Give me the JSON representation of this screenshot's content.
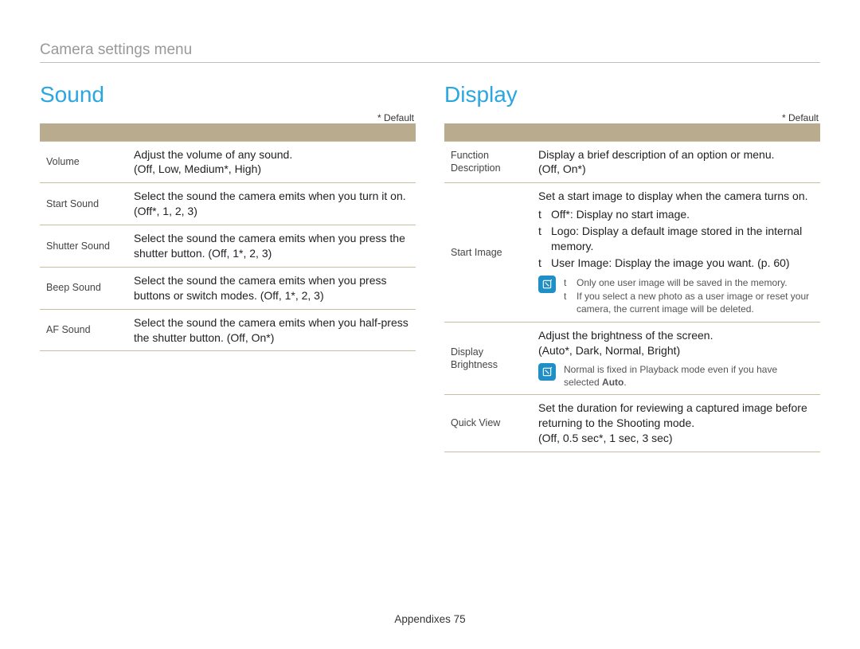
{
  "page_title": "Camera settings menu",
  "footer": {
    "label": "Appendixes",
    "page": "75"
  },
  "default_note": "* Default",
  "bullet_mark": "t",
  "sound": {
    "heading": "Sound",
    "header": {
      "item": "",
      "desc": ""
    },
    "rows": [
      {
        "item": "Volume",
        "desc": "Adjust the volume of any sound.",
        "opts": "(Off, Low, Medium*, High)"
      },
      {
        "item": "Start Sound",
        "desc": "Select the sound the camera emits when you turn it on. (Off*, 1, 2, 3)"
      },
      {
        "item": "Shutter Sound",
        "desc": "Select the sound the camera emits when you press the shutter button. (Off, 1*, 2, 3)"
      },
      {
        "item": "Beep Sound",
        "desc": "Select the sound the camera emits when you press buttons or switch modes. (Off, 1*, 2, 3)"
      },
      {
        "item": "AF Sound",
        "desc": "Select the sound the camera emits when you half-press the shutter button. (Off, On*)"
      }
    ]
  },
  "display": {
    "heading": "Display",
    "header": {
      "item": "",
      "desc": ""
    },
    "rows": {
      "func": {
        "item": "Function Description",
        "desc": "Display a brief description of an option or menu.",
        "opts": "(Off, On*)"
      },
      "start_image": {
        "item": "Start Image",
        "intro": "Set a start image to display when the camera turns on.",
        "bullets": [
          "Off*: Display no start image.",
          "Logo: Display a default image stored in the internal memory.",
          "User Image: Display the image you want. (p. 60)"
        ],
        "notes": [
          "Only one user image will be saved in the memory.",
          "If you select a new photo as a user image or reset your camera, the current image will be deleted."
        ]
      },
      "brightness": {
        "item": "Display Brightness",
        "desc": "Adjust the brightness of the screen.",
        "opts": "(Auto*, Dark, Normal, Bright)",
        "note_pre": "Normal is fixed in Playback mode even if you have selected",
        "note_bold": "Auto",
        "note_post": "."
      },
      "quick": {
        "item": "Quick View",
        "desc": "Set the duration for reviewing a captured image before returning to the Shooting mode.",
        "opts": "(Off, 0.5 sec*, 1 sec, 3 sec)"
      }
    }
  }
}
